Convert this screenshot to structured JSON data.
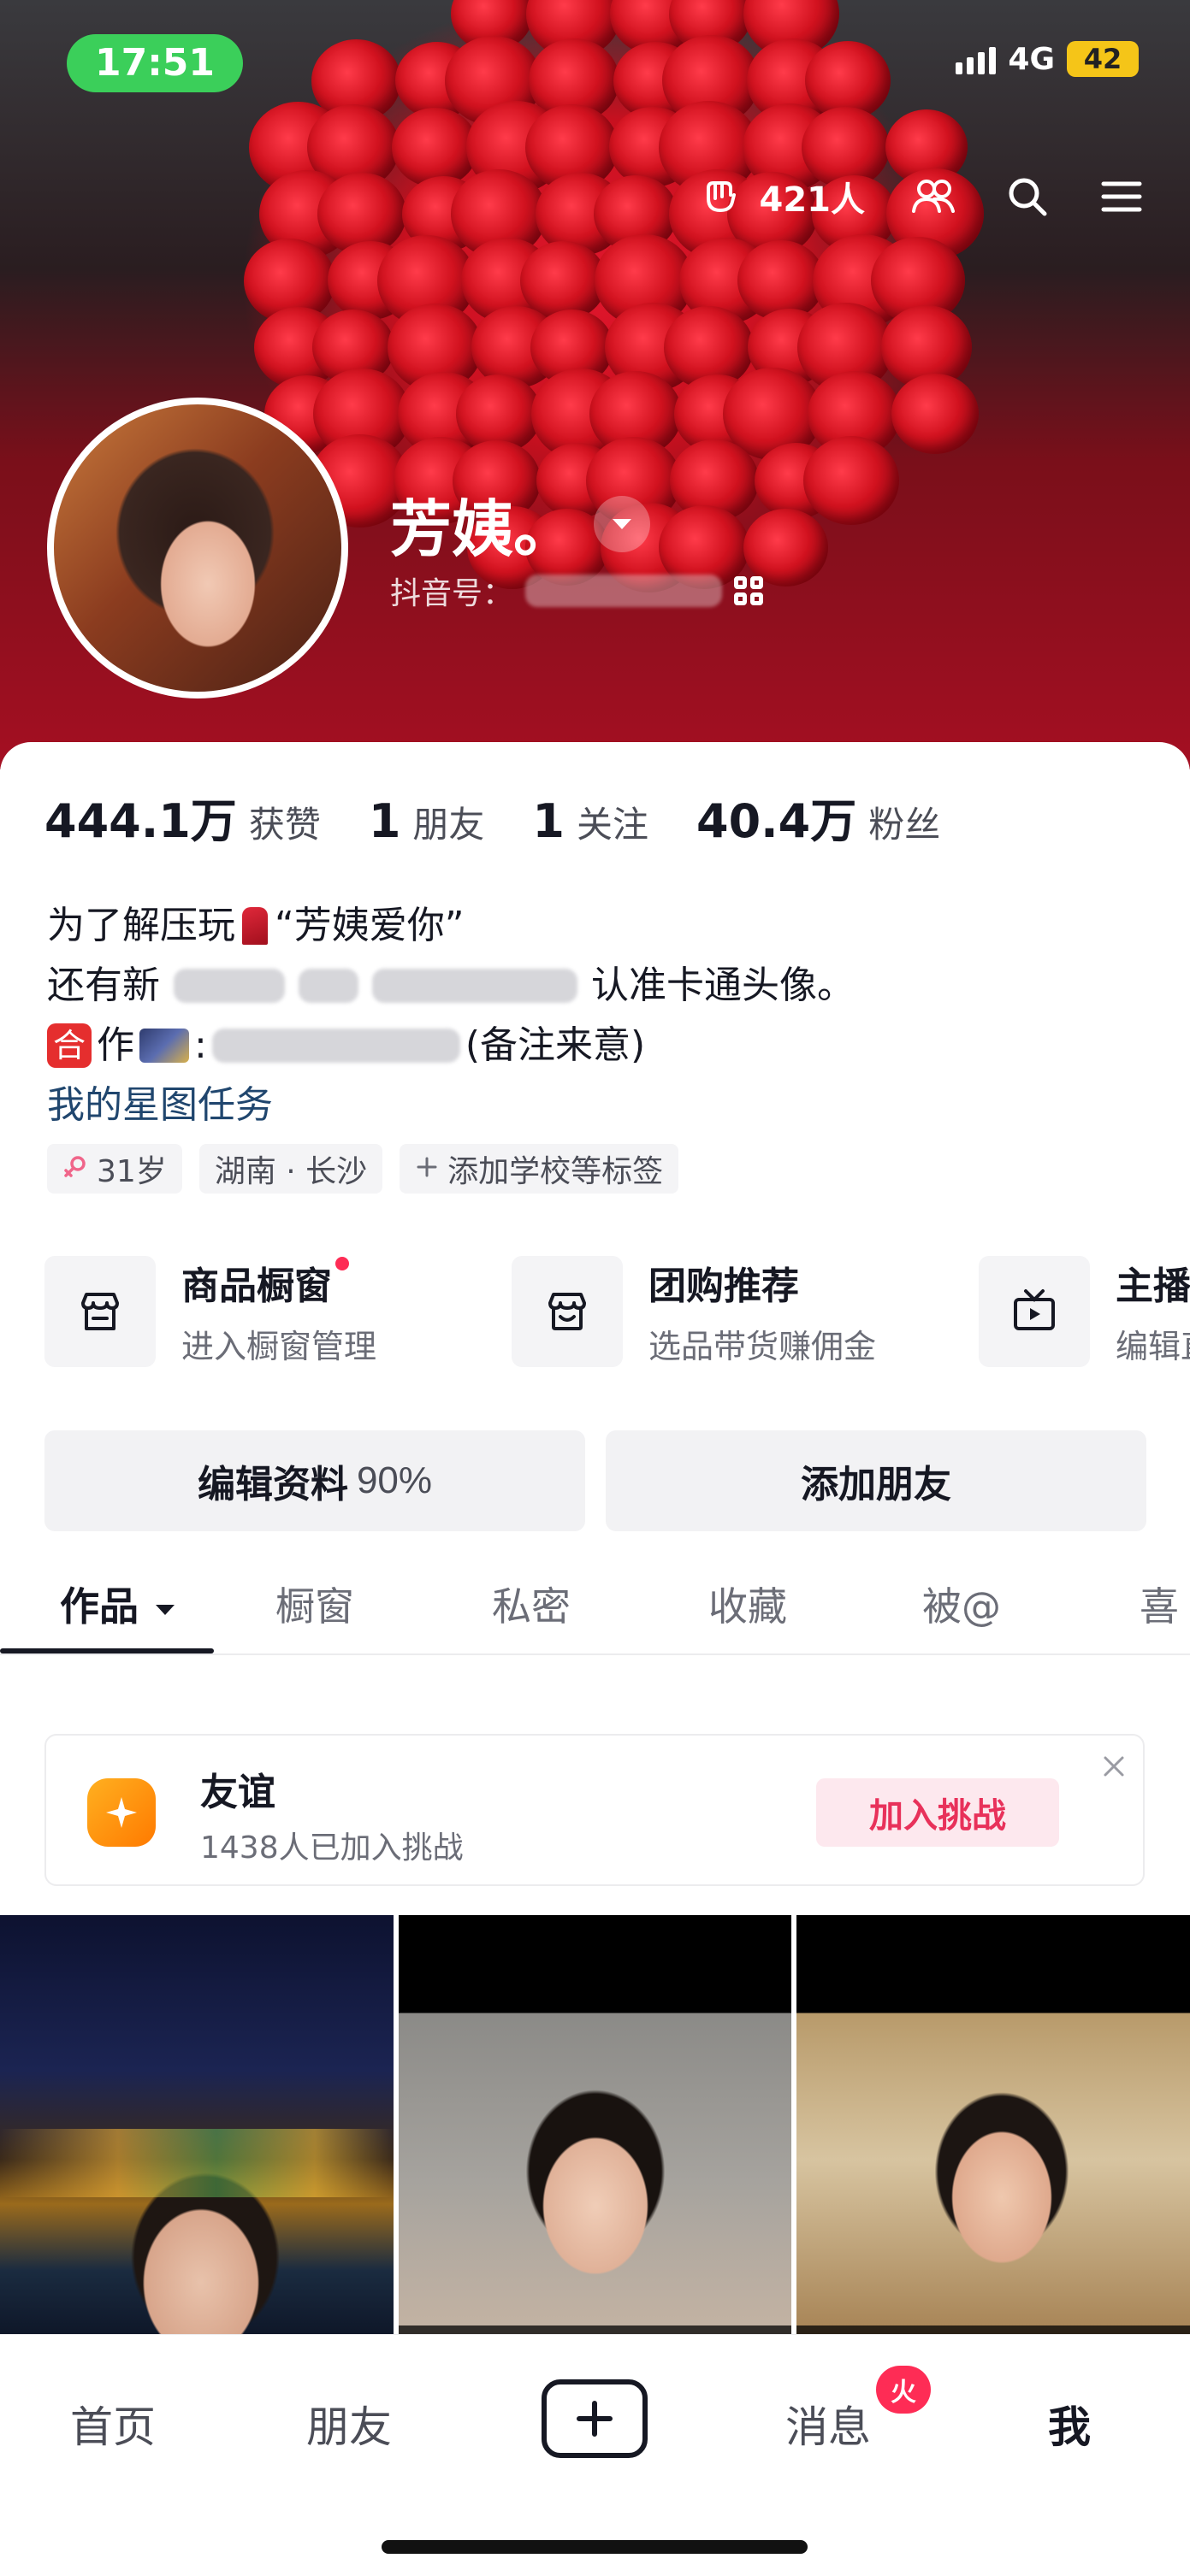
{
  "status_bar": {
    "time": "17:51",
    "network": "4G",
    "battery": "42"
  },
  "header": {
    "visitors_label": "421人",
    "icons": [
      "visitor-hand-icon",
      "friends-icon",
      "search-icon",
      "menu-icon"
    ]
  },
  "profile": {
    "name": "芳姨。",
    "id_label": "抖音号："
  },
  "stats": [
    {
      "value": "444.1万",
      "label": "获赞"
    },
    {
      "value": "1",
      "label": "朋友"
    },
    {
      "value": "1",
      "label": "关注"
    },
    {
      "value": "40.4万",
      "label": "粉丝"
    }
  ],
  "bio": {
    "line1_a": "为了解压玩",
    "line1_b": "“芳姨爱你”",
    "line2_a": "还有新",
    "line2_b": "认准卡通头像。",
    "line3_badge": "合",
    "line3_a": "作",
    "line3_b": "(备注来意)",
    "link": "我的星图任务"
  },
  "tags": [
    {
      "text": "31岁",
      "icon": "female-icon"
    },
    {
      "text": "湖南 · 长沙"
    },
    {
      "text": "添加学校等标签",
      "icon": "plus-icon"
    }
  ],
  "tools": [
    {
      "title": "商品橱窗",
      "sub": "进入橱窗管理",
      "icon": "shop-window-icon",
      "dot": true
    },
    {
      "title": "团购推荐",
      "sub": "选品带货赚佣金",
      "icon": "group-buy-icon"
    },
    {
      "title": "主播",
      "sub": "编辑直",
      "icon": "live-tv-icon"
    }
  ],
  "actions": {
    "edit_label": "编辑资料",
    "edit_pct": "90%",
    "add_friend_label": "添加朋友"
  },
  "tabs": [
    "作品",
    "橱窗",
    "私密",
    "收藏",
    "被@",
    "喜"
  ],
  "challenge": {
    "title": "友谊",
    "sub": "1438人已加入挑战",
    "button": "加入挑战"
  },
  "bottom_nav": {
    "home": "首页",
    "friends": "朋友",
    "messages": "消息",
    "messages_badge": "火",
    "me": "我"
  },
  "colors": {
    "accent": "#fe2c55",
    "status_green": "#3bcf5a",
    "battery_yellow": "#f5c518",
    "link_blue": "#20466e"
  }
}
